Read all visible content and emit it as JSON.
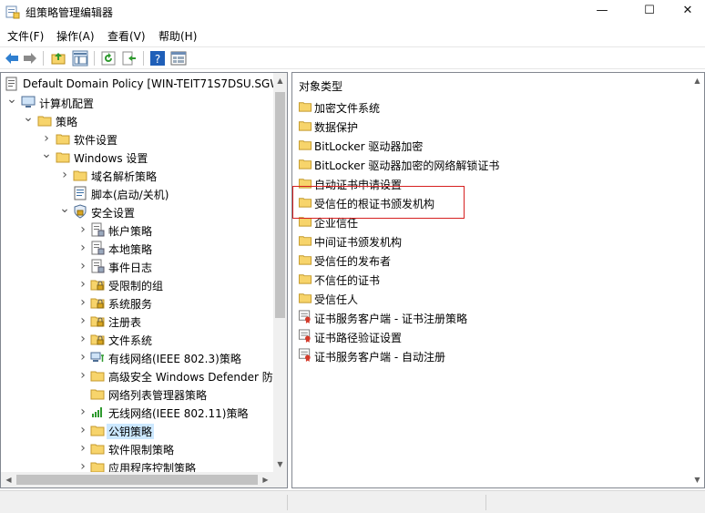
{
  "window": {
    "title": "组策略管理编辑器",
    "min": "—",
    "max": "☐",
    "close": "✕"
  },
  "menu": [
    "文件(F)",
    "操作(A)",
    "查看(V)",
    "帮助(H)"
  ],
  "toolbar": [
    "back-icon",
    "forward-icon",
    "up-folder-icon",
    "show-hide-tree-icon",
    "refresh-icon",
    "export-icon",
    "help-icon",
    "properties-icon"
  ],
  "tree": [
    {
      "label": "Default Domain Policy [WIN-TEIT71S7DSU.SGW",
      "level": 0,
      "twisty": "",
      "icon": "policy-icon"
    },
    {
      "label": "计算机配置",
      "level": 1,
      "twisty": "▼",
      "icon": "computer-icon"
    },
    {
      "label": "策略",
      "level": 2,
      "twisty": "▼",
      "icon": "folder-icon"
    },
    {
      "label": "软件设置",
      "level": 3,
      "twisty": "›",
      "icon": "folder-icon"
    },
    {
      "label": "Windows 设置",
      "level": 3,
      "twisty": "▼",
      "icon": "folder-icon"
    },
    {
      "label": "域名解析策略",
      "level": 4,
      "twisty": "›",
      "icon": "folder-icon"
    },
    {
      "label": "脚本(启动/关机)",
      "level": 4,
      "twisty": "",
      "icon": "script-icon"
    },
    {
      "label": "安全设置",
      "level": 4,
      "twisty": "▼",
      "icon": "security-icon"
    },
    {
      "label": "帐户策略",
      "level": 5,
      "twisty": "›",
      "icon": "policy-doc-icon"
    },
    {
      "label": "本地策略",
      "level": 5,
      "twisty": "›",
      "icon": "policy-doc-icon"
    },
    {
      "label": "事件日志",
      "level": 5,
      "twisty": "›",
      "icon": "policy-doc-icon"
    },
    {
      "label": "受限制的组",
      "level": 5,
      "twisty": "›",
      "icon": "locked-folder-icon"
    },
    {
      "label": "系统服务",
      "level": 5,
      "twisty": "›",
      "icon": "locked-folder-icon"
    },
    {
      "label": "注册表",
      "level": 5,
      "twisty": "›",
      "icon": "locked-folder-icon"
    },
    {
      "label": "文件系统",
      "level": 5,
      "twisty": "›",
      "icon": "locked-folder-icon"
    },
    {
      "label": "有线网络(IEEE 802.3)策略",
      "level": 5,
      "twisty": "›",
      "icon": "network-icon"
    },
    {
      "label": "高级安全 Windows Defender 防",
      "level": 5,
      "twisty": "›",
      "icon": "folder-icon"
    },
    {
      "label": "网络列表管理器策略",
      "level": 5,
      "twisty": "",
      "icon": "folder-icon"
    },
    {
      "label": "无线网络(IEEE 802.11)策略",
      "level": 5,
      "twisty": "›",
      "icon": "wireless-icon"
    },
    {
      "label": "公钥策略",
      "level": 5,
      "twisty": "›",
      "icon": "folder-icon",
      "selected": true
    },
    {
      "label": "软件限制策略",
      "level": 5,
      "twisty": "›",
      "icon": "folder-icon"
    },
    {
      "label": "应用程序控制策略",
      "level": 5,
      "twisty": "›",
      "icon": "folder-icon"
    }
  ],
  "right": {
    "header": "对象类型",
    "items": [
      {
        "label": "加密文件系统",
        "icon": "folder-icon"
      },
      {
        "label": "数据保护",
        "icon": "folder-icon"
      },
      {
        "label": "BitLocker 驱动器加密",
        "icon": "folder-icon"
      },
      {
        "label": "BitLocker 驱动器加密的网络解锁证书",
        "icon": "folder-icon"
      },
      {
        "label": "自动证书申请设置",
        "icon": "folder-icon"
      },
      {
        "label": "受信任的根证书颁发机构",
        "icon": "folder-icon"
      },
      {
        "label": "企业信任",
        "icon": "folder-icon"
      },
      {
        "label": "中间证书颁发机构",
        "icon": "folder-icon"
      },
      {
        "label": "受信任的发布者",
        "icon": "folder-icon"
      },
      {
        "label": "不信任的证书",
        "icon": "folder-icon"
      },
      {
        "label": "受信任人",
        "icon": "folder-icon"
      },
      {
        "label": "证书服务客户端 - 证书注册策略",
        "icon": "certificate-policy-icon"
      },
      {
        "label": "证书路径验证设置",
        "icon": "certificate-policy-icon"
      },
      {
        "label": "证书服务客户端 - 自动注册",
        "icon": "certificate-policy-icon"
      }
    ]
  },
  "colors": {
    "highlight_box": "#d62020",
    "selection": "#cce8ff",
    "folder": "#f7d46b"
  }
}
